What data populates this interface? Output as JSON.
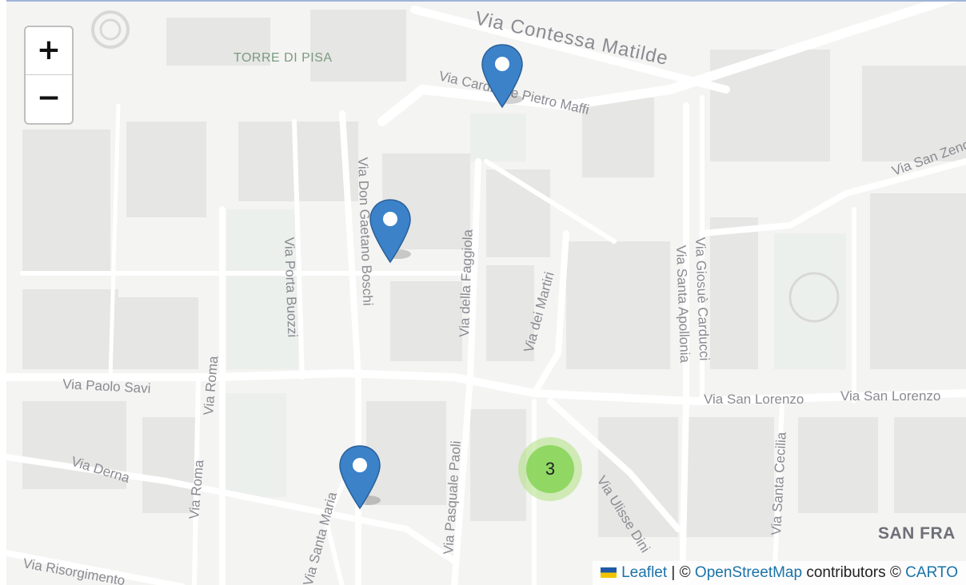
{
  "map": {
    "streets": {
      "contessa_matilde": "Via Contessa Matilde",
      "cardinale_maffi": "Via Cardinale Pietro Maffi",
      "san_zeno": "Via San Zeno",
      "don_boschi": "Via Don Gaetano Boschi",
      "faggiola": "Via della Faggiola",
      "porta_buozzi": "Via Porta Buozzi",
      "martiri": "Via dei Martiri",
      "santa_apollonia": "Via Santa Apollonia",
      "giosue_carducci": "Via Giosuè Carducci",
      "paolo_savi": "Via Paolo Savi",
      "roma_upper": "Via Roma",
      "roma_lower": "Via Roma",
      "san_lorenzo_a": "Via San Lorenzo",
      "san_lorenzo_b": "Via San Lorenzo",
      "pasquale_paoli": "Via Pasquale Paoli",
      "derna": "Via Derna",
      "ulisse_dini": "Via Ulisse Dini",
      "santa_cecilia": "Via Santa Cecilia",
      "risorgimento": "Via Risorgimento",
      "santa_maria": "Via Santa Maria"
    },
    "places": {
      "torre": "TORRE DI PISA",
      "san_francesco": "SAN FRA"
    }
  },
  "controls": {
    "zoom_in": "+",
    "zoom_out": "−"
  },
  "markers": [
    "marker-1",
    "marker-2",
    "marker-3"
  ],
  "cluster": {
    "count": "3"
  },
  "attribution": {
    "leaflet": "Leaflet",
    "sep1": " | © ",
    "osm": "OpenStreetMap",
    "contributors": " contributors © ",
    "carto": "CARTO"
  },
  "colors": {
    "pin": "#3b82c9",
    "cluster_outer": "#b5e28c",
    "cluster_inner": "#6ecc39",
    "link": "#1a73a8"
  }
}
